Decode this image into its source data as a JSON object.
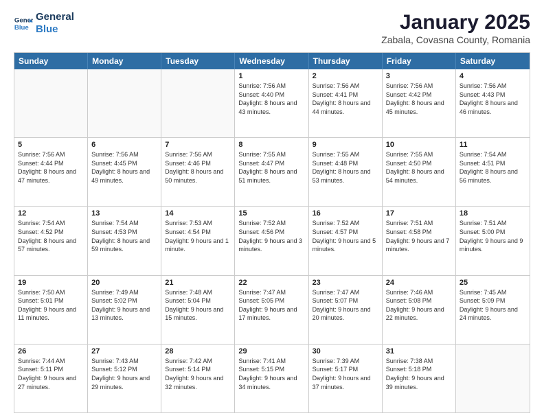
{
  "header": {
    "logo": {
      "line1": "General",
      "line2": "Blue"
    },
    "title": "January 2025",
    "subtitle": "Zabala, Covasna County, Romania"
  },
  "calendar": {
    "weekdays": [
      "Sunday",
      "Monday",
      "Tuesday",
      "Wednesday",
      "Thursday",
      "Friday",
      "Saturday"
    ],
    "rows": [
      [
        {
          "day": "",
          "info": ""
        },
        {
          "day": "",
          "info": ""
        },
        {
          "day": "",
          "info": ""
        },
        {
          "day": "1",
          "info": "Sunrise: 7:56 AM\nSunset: 4:40 PM\nDaylight: 8 hours\nand 43 minutes."
        },
        {
          "day": "2",
          "info": "Sunrise: 7:56 AM\nSunset: 4:41 PM\nDaylight: 8 hours\nand 44 minutes."
        },
        {
          "day": "3",
          "info": "Sunrise: 7:56 AM\nSunset: 4:42 PM\nDaylight: 8 hours\nand 45 minutes."
        },
        {
          "day": "4",
          "info": "Sunrise: 7:56 AM\nSunset: 4:43 PM\nDaylight: 8 hours\nand 46 minutes."
        }
      ],
      [
        {
          "day": "5",
          "info": "Sunrise: 7:56 AM\nSunset: 4:44 PM\nDaylight: 8 hours\nand 47 minutes."
        },
        {
          "day": "6",
          "info": "Sunrise: 7:56 AM\nSunset: 4:45 PM\nDaylight: 8 hours\nand 49 minutes."
        },
        {
          "day": "7",
          "info": "Sunrise: 7:56 AM\nSunset: 4:46 PM\nDaylight: 8 hours\nand 50 minutes."
        },
        {
          "day": "8",
          "info": "Sunrise: 7:55 AM\nSunset: 4:47 PM\nDaylight: 8 hours\nand 51 minutes."
        },
        {
          "day": "9",
          "info": "Sunrise: 7:55 AM\nSunset: 4:48 PM\nDaylight: 8 hours\nand 53 minutes."
        },
        {
          "day": "10",
          "info": "Sunrise: 7:55 AM\nSunset: 4:50 PM\nDaylight: 8 hours\nand 54 minutes."
        },
        {
          "day": "11",
          "info": "Sunrise: 7:54 AM\nSunset: 4:51 PM\nDaylight: 8 hours\nand 56 minutes."
        }
      ],
      [
        {
          "day": "12",
          "info": "Sunrise: 7:54 AM\nSunset: 4:52 PM\nDaylight: 8 hours\nand 57 minutes."
        },
        {
          "day": "13",
          "info": "Sunrise: 7:54 AM\nSunset: 4:53 PM\nDaylight: 8 hours\nand 59 minutes."
        },
        {
          "day": "14",
          "info": "Sunrise: 7:53 AM\nSunset: 4:54 PM\nDaylight: 9 hours\nand 1 minute."
        },
        {
          "day": "15",
          "info": "Sunrise: 7:52 AM\nSunset: 4:56 PM\nDaylight: 9 hours\nand 3 minutes."
        },
        {
          "day": "16",
          "info": "Sunrise: 7:52 AM\nSunset: 4:57 PM\nDaylight: 9 hours\nand 5 minutes."
        },
        {
          "day": "17",
          "info": "Sunrise: 7:51 AM\nSunset: 4:58 PM\nDaylight: 9 hours\nand 7 minutes."
        },
        {
          "day": "18",
          "info": "Sunrise: 7:51 AM\nSunset: 5:00 PM\nDaylight: 9 hours\nand 9 minutes."
        }
      ],
      [
        {
          "day": "19",
          "info": "Sunrise: 7:50 AM\nSunset: 5:01 PM\nDaylight: 9 hours\nand 11 minutes."
        },
        {
          "day": "20",
          "info": "Sunrise: 7:49 AM\nSunset: 5:02 PM\nDaylight: 9 hours\nand 13 minutes."
        },
        {
          "day": "21",
          "info": "Sunrise: 7:48 AM\nSunset: 5:04 PM\nDaylight: 9 hours\nand 15 minutes."
        },
        {
          "day": "22",
          "info": "Sunrise: 7:47 AM\nSunset: 5:05 PM\nDaylight: 9 hours\nand 17 minutes."
        },
        {
          "day": "23",
          "info": "Sunrise: 7:47 AM\nSunset: 5:07 PM\nDaylight: 9 hours\nand 20 minutes."
        },
        {
          "day": "24",
          "info": "Sunrise: 7:46 AM\nSunset: 5:08 PM\nDaylight: 9 hours\nand 22 minutes."
        },
        {
          "day": "25",
          "info": "Sunrise: 7:45 AM\nSunset: 5:09 PM\nDaylight: 9 hours\nand 24 minutes."
        }
      ],
      [
        {
          "day": "26",
          "info": "Sunrise: 7:44 AM\nSunset: 5:11 PM\nDaylight: 9 hours\nand 27 minutes."
        },
        {
          "day": "27",
          "info": "Sunrise: 7:43 AM\nSunset: 5:12 PM\nDaylight: 9 hours\nand 29 minutes."
        },
        {
          "day": "28",
          "info": "Sunrise: 7:42 AM\nSunset: 5:14 PM\nDaylight: 9 hours\nand 32 minutes."
        },
        {
          "day": "29",
          "info": "Sunrise: 7:41 AM\nSunset: 5:15 PM\nDaylight: 9 hours\nand 34 minutes."
        },
        {
          "day": "30",
          "info": "Sunrise: 7:39 AM\nSunset: 5:17 PM\nDaylight: 9 hours\nand 37 minutes."
        },
        {
          "day": "31",
          "info": "Sunrise: 7:38 AM\nSunset: 5:18 PM\nDaylight: 9 hours\nand 39 minutes."
        },
        {
          "day": "",
          "info": ""
        }
      ]
    ]
  }
}
